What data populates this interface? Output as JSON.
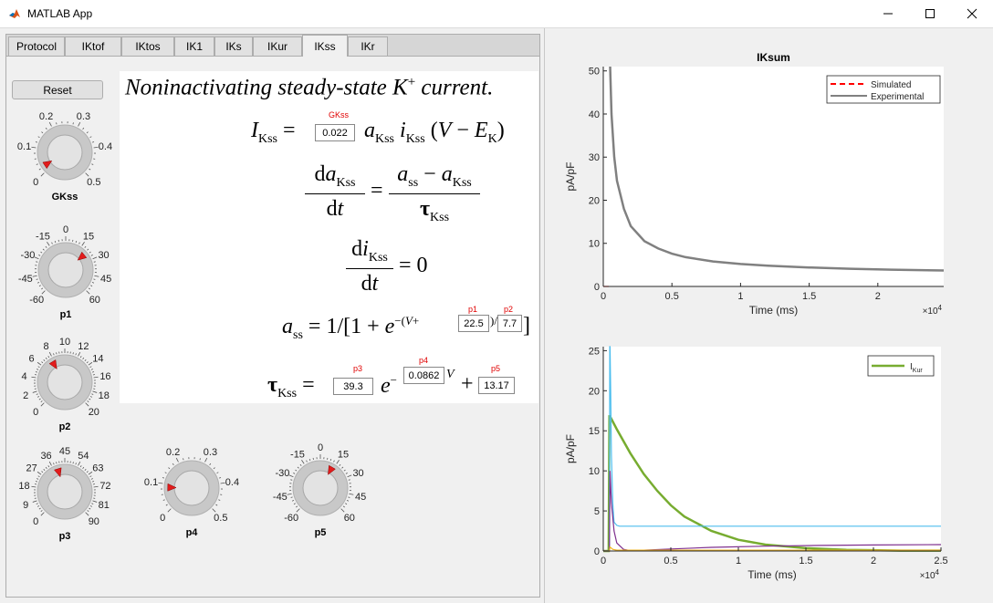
{
  "window": {
    "title": "MATLAB App",
    "controls": {
      "minimize": "minimize-icon",
      "maximize": "maximize-icon",
      "close": "close-icon"
    }
  },
  "tabs": [
    {
      "label": "Protocol",
      "active": false
    },
    {
      "label": "IKtof",
      "active": false
    },
    {
      "label": "IKtos",
      "active": false
    },
    {
      "label": "IK1",
      "active": false
    },
    {
      "label": "IKs",
      "active": false
    },
    {
      "label": "IKur",
      "active": false
    },
    {
      "label": "IKss",
      "active": true
    },
    {
      "label": "IKr",
      "active": false
    }
  ],
  "reset_label": "Reset",
  "equation": {
    "heading": "Noninactivating steady-state K",
    "heading_sup": "+",
    "heading_tail": " current.",
    "params": {
      "GKss": {
        "label": "GKss",
        "value": "0.022"
      },
      "p1": {
        "label": "p1",
        "value": "22.5"
      },
      "p2": {
        "label": "p2",
        "value": "7.7"
      },
      "p3": {
        "label": "p3",
        "value": "39.3"
      },
      "p4": {
        "label": "p4",
        "value": "0.0862"
      },
      "p5": {
        "label": "p5",
        "value": "13.17"
      }
    }
  },
  "knobs": [
    {
      "name": "GKss",
      "ticks": [
        "0",
        "0.1",
        "0.2",
        "0.3",
        "0.4",
        "0.5"
      ],
      "min": 0,
      "max": 0.5,
      "value": 0.022
    },
    {
      "name": "p1",
      "ticks": [
        "-60",
        "-45",
        "-30",
        "-15",
        "0",
        "15",
        "30",
        "45",
        "60"
      ],
      "min": -60,
      "max": 60,
      "value": 22.5
    },
    {
      "name": "p2",
      "ticks": [
        "0",
        "2",
        "4",
        "6",
        "8",
        "10",
        "12",
        "14",
        "16",
        "18",
        "20"
      ],
      "min": 0,
      "max": 20,
      "value": 7.7
    },
    {
      "name": "p3",
      "ticks": [
        "0",
        "9",
        "18",
        "27",
        "36",
        "45",
        "54",
        "63",
        "72",
        "81",
        "90"
      ],
      "min": 0,
      "max": 90,
      "value": 39.3
    },
    {
      "name": "p4",
      "ticks": [
        "0",
        "0.1",
        "0.2",
        "0.3",
        "0.4",
        "0.5"
      ],
      "min": 0,
      "max": 0.5,
      "value": 0.0862
    },
    {
      "name": "p5",
      "ticks": [
        "-60",
        "-45",
        "-30",
        "-15",
        "0",
        "15",
        "30",
        "45",
        "60"
      ],
      "min": -60,
      "max": 60,
      "value": 13.17
    }
  ],
  "chart_data": [
    {
      "type": "line",
      "title": "IKsum",
      "xlabel": "Time (ms)",
      "ylabel": "pA/pF",
      "xlim": [
        0,
        24800
      ],
      "ylim": [
        0,
        51
      ],
      "x_ticks": [
        0,
        5000,
        10000,
        15000,
        20000
      ],
      "x_tick_labels": [
        "0",
        "0.5",
        "1",
        "1.5",
        "2"
      ],
      "x_exponent": "×10",
      "x_exponent_power": "4",
      "y_ticks": [
        0,
        10,
        20,
        30,
        40,
        50
      ],
      "legend": "top-right",
      "series": [
        {
          "name": "Simulated",
          "color": "#ff0000",
          "style": "dashed",
          "x": [
            0,
            400,
            500
          ],
          "y": [
            0,
            0,
            0
          ]
        },
        {
          "name": "Experimental",
          "color": "#808080",
          "style": "solid",
          "x": [
            500,
            600,
            800,
            1000,
            1500,
            2000,
            3000,
            4000,
            5000,
            6000,
            8000,
            10000,
            12000,
            15000,
            18000,
            21000,
            24800
          ],
          "y": [
            51,
            40,
            30,
            24.5,
            18,
            14,
            10.5,
            8.8,
            7.6,
            6.8,
            5.8,
            5.2,
            4.8,
            4.4,
            4.1,
            3.9,
            3.7
          ]
        }
      ]
    },
    {
      "type": "line",
      "title": "",
      "xlabel": "Time (ms)",
      "ylabel": "pA/pF",
      "xlim": [
        0,
        25000
      ],
      "ylim": [
        0,
        25.5
      ],
      "x_ticks": [
        0,
        5000,
        10000,
        15000,
        20000,
        25000
      ],
      "x_tick_labels": [
        "0",
        "0.5",
        "1",
        "1.5",
        "2",
        "2.5"
      ],
      "x_exponent": "×10",
      "x_exponent_power": "4",
      "y_ticks": [
        0,
        5,
        10,
        15,
        20,
        25
      ],
      "legend": "top-right",
      "legend_label": "I",
      "legend_sub": "Kur",
      "series": [
        {
          "name": "IKur",
          "color": "#77ac30",
          "x": [
            0,
            400,
            450,
            500,
            1000,
            2000,
            3000,
            4000,
            5000,
            6000,
            8000,
            10000,
            12000,
            15000,
            18000,
            20000,
            22000,
            25000
          ],
          "y": [
            0,
            0,
            16.8,
            16.8,
            15.2,
            12.2,
            9.6,
            7.5,
            5.7,
            4.3,
            2.5,
            1.4,
            0.8,
            0.35,
            0.15,
            0.1,
            0.05,
            0.05
          ]
        },
        {
          "name": "",
          "color": "#4dbeee",
          "x": [
            0,
            450,
            480,
            500,
            550,
            600,
            700,
            800,
            1000,
            1200,
            25000
          ],
          "y": [
            0,
            0,
            25.5,
            25.5,
            20,
            12,
            6,
            3.6,
            3.2,
            3.1,
            3.1
          ]
        },
        {
          "name": "",
          "color": "#7e2f8e",
          "x": [
            0,
            450,
            500,
            600,
            800,
            1000,
            1500,
            2000,
            3000,
            5000,
            8000,
            12000,
            16000,
            20000,
            25000
          ],
          "y": [
            0,
            0,
            10,
            6,
            2.5,
            1,
            0.2,
            0.05,
            0.1,
            0.25,
            0.45,
            0.6,
            0.7,
            0.75,
            0.8
          ]
        },
        {
          "name": "",
          "color": "#edb120",
          "x": [
            0,
            450,
            500,
            700,
            1000,
            25000
          ],
          "y": [
            0,
            0,
            0.5,
            0.2,
            0.1,
            0.1
          ]
        }
      ]
    }
  ]
}
